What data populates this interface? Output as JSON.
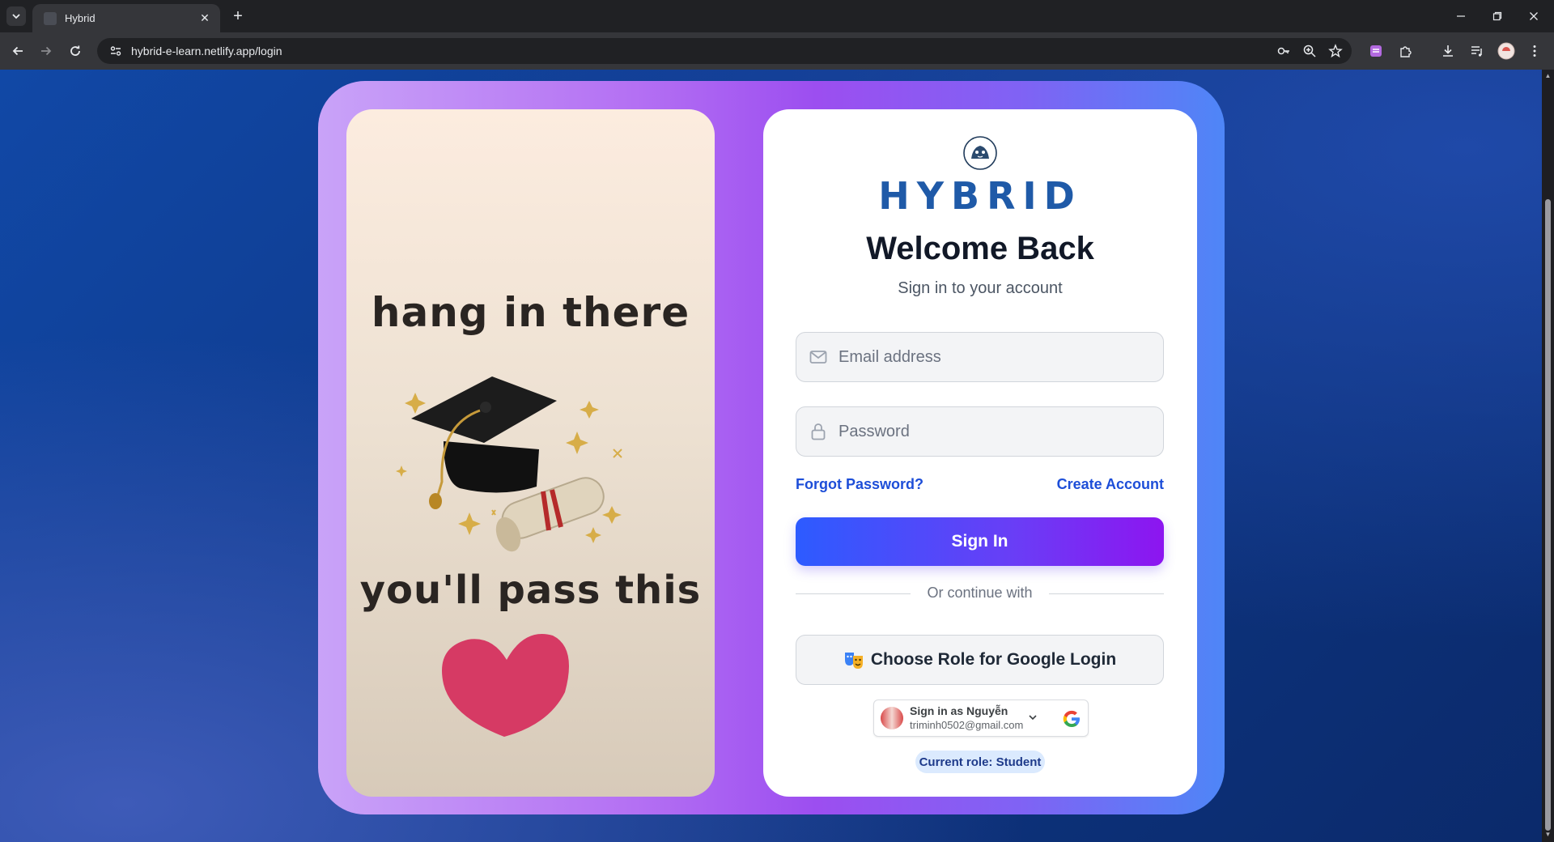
{
  "browser": {
    "tab_title": "Hybrid",
    "tab_close": "✕",
    "new_tab": "+",
    "url": "hybrid-e-learn.netlify.app/login",
    "window_controls": [
      "minimize-icon",
      "restore-icon",
      "close-icon"
    ],
    "toolbar_icons": [
      "key-icon",
      "zoom-icon",
      "star-icon",
      "extension-purple-icon",
      "puzzle-icon",
      "download-icon",
      "media-icon",
      "profile-icon",
      "kebab-menu-icon"
    ]
  },
  "left_panel": {
    "motto_top": "hang in there",
    "motto_bottom": "you'll pass this"
  },
  "login": {
    "brand": "HYBRID",
    "title": "Welcome Back",
    "subtitle": "Sign in to your account",
    "email_placeholder": "Email address",
    "password_placeholder": "Password",
    "forgot_password": "Forgot Password?",
    "create_account": "Create Account",
    "sign_in": "Sign In",
    "divider": "Or continue with",
    "google_role": "Choose Role for Google Login",
    "google_signin_name": "Sign in as Nguyễn",
    "google_signin_email": "triminh0502@gmail.com",
    "current_role": "Current role: Student"
  },
  "colors": {
    "brand_blue": "#1f5aa8",
    "button_gradient_start": "#2d5bff",
    "button_gradient_end": "#8d15f0",
    "link": "#1d4ed8"
  }
}
